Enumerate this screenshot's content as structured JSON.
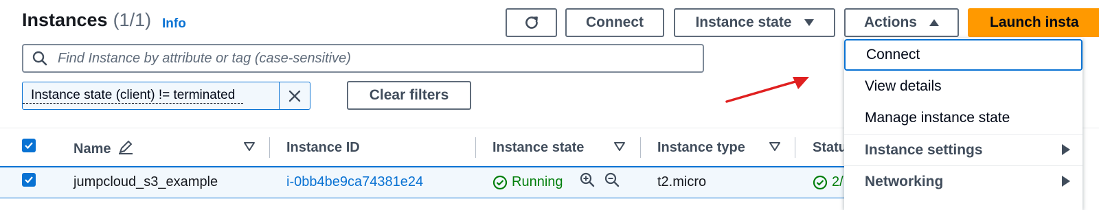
{
  "header": {
    "title": "Instances",
    "count": "(1/1)",
    "info_label": "Info"
  },
  "toolbar": {
    "connect_label": "Connect",
    "instance_state_label": "Instance state",
    "actions_label": "Actions",
    "launch_label": "Launch insta"
  },
  "search": {
    "placeholder": "Find Instance by attribute or tag (case-sensitive)"
  },
  "filters": {
    "token_label": "Instance state (client) != terminated",
    "clear_label": "Clear filters"
  },
  "table": {
    "columns": [
      "Name",
      "Instance ID",
      "Instance state",
      "Instance type",
      "Statu"
    ],
    "rows": [
      {
        "name": "jumpcloud_s3_example",
        "instance_id": "i-0bb4be9ca74381e24",
        "state": "Running",
        "type": "t2.micro",
        "status": "2/"
      }
    ]
  },
  "actions_menu": {
    "items": [
      "Connect",
      "View details",
      "Manage instance state"
    ],
    "groups": [
      "Instance settings",
      "Networking"
    ]
  },
  "colors": {
    "accent": "#0972d3",
    "primary_button": "#ff9900",
    "success": "#037f0c",
    "annotation_arrow": "#e02020"
  }
}
